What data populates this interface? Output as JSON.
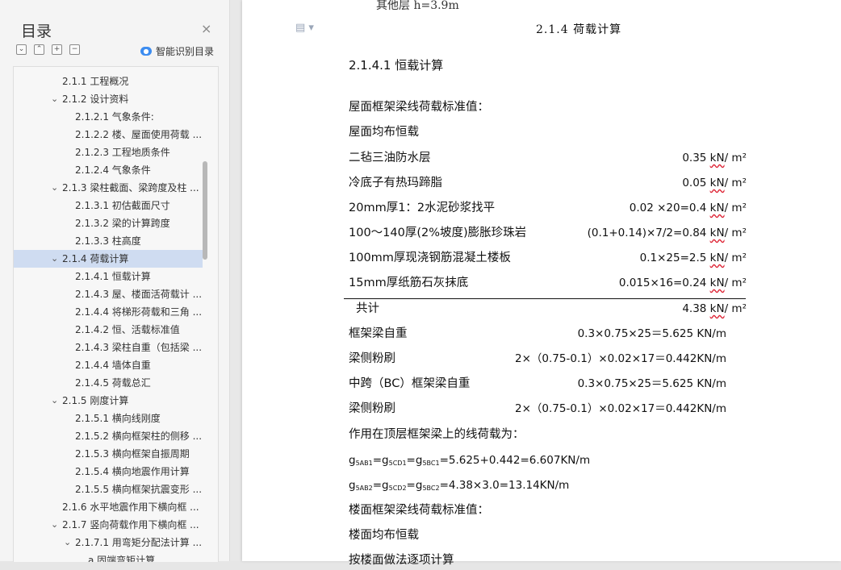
{
  "sidebar": {
    "title": "目录",
    "close_icon": "×",
    "tools": [
      "⌄",
      "⌃",
      "+",
      "−"
    ],
    "smart_label": "智能识别目录",
    "toc": [
      {
        "label": "2.1.1  工程概况",
        "level": 1,
        "arrow": ""
      },
      {
        "label": "2.1.2  设计资料",
        "level": 1,
        "arrow": "⌄"
      },
      {
        "label": "2.1.2.1 气象条件:",
        "level": 2,
        "arrow": ""
      },
      {
        "label": "2.1.2.2 楼、屋面使用荷载 ...",
        "level": 2,
        "arrow": ""
      },
      {
        "label": "2.1.2.3  工程地质条件",
        "level": 2,
        "arrow": ""
      },
      {
        "label": "2.1.2.4  气象条件",
        "level": 2,
        "arrow": ""
      },
      {
        "label": "2.1.3  梁柱截面、梁跨度及柱 ...",
        "level": 1,
        "arrow": "⌄"
      },
      {
        "label": "2.1.3.1  初估截面尺寸",
        "level": 2,
        "arrow": ""
      },
      {
        "label": "2.1.3.2  梁的计算跨度",
        "level": 2,
        "arrow": ""
      },
      {
        "label": "2.1.3.3  柱高度",
        "level": 2,
        "arrow": ""
      },
      {
        "label": "2.1.4  荷载计算",
        "level": 1,
        "arrow": "⌄",
        "selected": true
      },
      {
        "label": "2.1.4.1 恒载计算",
        "level": 2,
        "arrow": ""
      },
      {
        "label": "2.1.4.3 屋、楼面活荷载计 ...",
        "level": 2,
        "arrow": ""
      },
      {
        "label": "2.1.4.4  将梯形荷载和三角 ...",
        "level": 2,
        "arrow": ""
      },
      {
        "label": "2.1.4.2 恒、活载标准值",
        "level": 2,
        "arrow": ""
      },
      {
        "label": "2.1.4.3  梁柱自重（包括梁 ...",
        "level": 2,
        "arrow": ""
      },
      {
        "label": "2.1.4.4  墙体自重",
        "level": 2,
        "arrow": ""
      },
      {
        "label": "2.1.4.5 荷载总汇",
        "level": 2,
        "arrow": ""
      },
      {
        "label": "2.1.5  刚度计算",
        "level": 1,
        "arrow": "⌄"
      },
      {
        "label": "2.1.5.1  横向线刚度",
        "level": 2,
        "arrow": ""
      },
      {
        "label": "2.1.5.2  横向框架柱的侧移 ...",
        "level": 2,
        "arrow": ""
      },
      {
        "label": "2.1.5.3  横向框架自振周期",
        "level": 2,
        "arrow": ""
      },
      {
        "label": "2.1.5.4  横向地震作用计算",
        "level": 2,
        "arrow": ""
      },
      {
        "label": "2.1.5.5  横向框架抗震变形 ...",
        "level": 2,
        "arrow": ""
      },
      {
        "label": "2.1.6  水平地震作用下横向框 ...",
        "level": 1,
        "arrow": ""
      },
      {
        "label": "2.1.7  竖向荷载作用下横向框 ...",
        "level": 1,
        "arrow": "⌄"
      },
      {
        "label": "2.1.7.1 用弯矩分配法计算 ...",
        "level": 2,
        "arrow": "⌄"
      },
      {
        "label": "a.固端弯矩计算",
        "level": 3,
        "arrow": ""
      }
    ]
  },
  "doc": {
    "cut_top": "其他层    h=3.9m",
    "heading": "2.1.4  荷载计算",
    "subheading": "2.1.4.1 恒载计算",
    "roof_title": "屋面框架梁线荷载标准值：",
    "roof_uniform": "屋面均布恒载",
    "rows": [
      {
        "label": "二毡三油防水层",
        "value": "0.35 ",
        "unit": "kN",
        "tail": "/ m²"
      },
      {
        "label": "冷底子有热玛蹄脂",
        "value": "0.05 ",
        "unit": "kN",
        "tail": "/ m²"
      },
      {
        "label": "20mm厚1：2水泥砂浆找平",
        "value": "0.02 ×20=0.4 ",
        "unit": "kN",
        "tail": "/ m²"
      },
      {
        "label": "100～140厚(2%坡度)膨胀珍珠岩",
        "value": "(0.1+0.14)×7/2=0.84 ",
        "unit": "kN",
        "tail": "/ m²"
      },
      {
        "label": "100mm厚现浇钢筋混凝土楼板",
        "value": "0.1×25=2.5 ",
        "unit": "kN",
        "tail": "/ m²"
      },
      {
        "label": "15mm厚纸筋石灰抹底",
        "value": "0.015×16=0.24 ",
        "unit": "kN",
        "tail": "/ m²"
      }
    ],
    "total_label": "共计",
    "total_value": "4.38 ",
    "total_unit": "kN",
    "total_tail": "/ m²",
    "beam_rows": [
      {
        "label": "框架梁自重",
        "value": "0.3×0.75×25＝5.625 KN/m"
      },
      {
        "label": "梁侧粉刷",
        "value": "2×（0.75-0.1）×0.02×17＝0.442KN/m"
      },
      {
        "label": "中跨（BC）框架梁自重",
        "value": "0.3×0.75×25＝5.625 KN/m"
      },
      {
        "label": "梁侧粉刷",
        "value": "2×（0.75-0.1）×0.02×17＝0.442KN/m"
      }
    ],
    "top_line_title": "作用在顶层框架梁上的线荷载为：",
    "formula1": {
      "g": "g",
      "s1": "5AB1",
      "s2": "5CD1",
      "s3": "5BC1",
      "rest": "=5.625+0.442=6.607KN/m"
    },
    "formula2": {
      "g": "g",
      "s1": "5AB2",
      "s2": "5CD2",
      "s3": "5BC2",
      "rest": "=4.38×3.0=13.14KN/m"
    },
    "floor_title": "楼面框架梁线荷载标准值：",
    "floor_uniform": "楼面均布恒载",
    "cut_bottom": "按楼面做法逐项计算"
  }
}
